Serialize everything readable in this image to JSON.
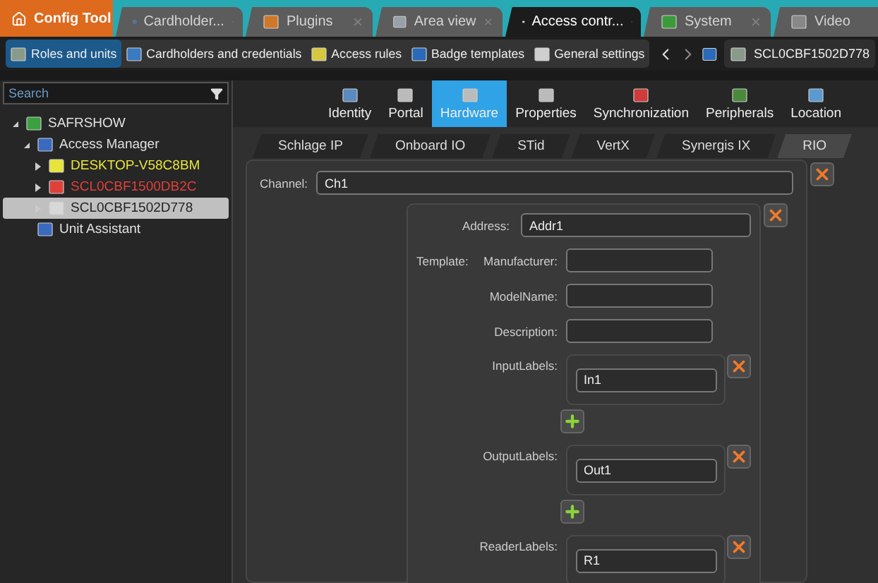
{
  "app_button": {
    "label": "Config Tool"
  },
  "tabs": [
    {
      "label": "Cardholder...",
      "selected": false
    },
    {
      "label": "Plugins",
      "selected": false
    },
    {
      "label": "Area view",
      "selected": false
    },
    {
      "label": "Access contr...",
      "selected": true
    },
    {
      "label": "System",
      "selected": false
    },
    {
      "label": "Video",
      "selected": false
    }
  ],
  "toolbar": {
    "items": [
      {
        "label": "Roles and units",
        "selected": true
      },
      {
        "label": "Cardholders and credentials",
        "selected": false
      },
      {
        "label": "Access rules",
        "selected": false
      },
      {
        "label": "Badge templates",
        "selected": false
      },
      {
        "label": "General settings",
        "selected": false
      }
    ],
    "entity_field": {
      "value": "SCL0CBF1502D778"
    }
  },
  "sidebar": {
    "search": {
      "placeholder": "Search"
    },
    "tree": [
      {
        "label": "SAFRSHOW",
        "selected": false,
        "expanded": true,
        "children": [
          {
            "label": "Access Manager",
            "selected": false,
            "expanded": true,
            "children": [
              {
                "label": "DESKTOP-V58C8BM",
                "selected": false,
                "expanded": false,
                "color": "#e8e43a"
              },
              {
                "label": "SCL0CBF1500DB2C",
                "selected": false,
                "expanded": false,
                "color": "#e0403a"
              },
              {
                "label": "SCL0CBF1502D778",
                "selected": true,
                "expanded": false,
                "color": "#d8d8d8"
              }
            ]
          },
          {
            "label": "Unit Assistant",
            "selected": false
          }
        ]
      }
    ]
  },
  "nav_tabs": [
    {
      "label": "Identity",
      "selected": false
    },
    {
      "label": "Portal",
      "selected": false
    },
    {
      "label": "Hardware",
      "selected": true
    },
    {
      "label": "Properties",
      "selected": false
    },
    {
      "label": "Synchronization",
      "selected": false
    },
    {
      "label": "Peripherals",
      "selected": false
    },
    {
      "label": "Location",
      "selected": false
    }
  ],
  "sub_tabs": [
    {
      "label": "Schlage IP",
      "selected": false
    },
    {
      "label": "Onboard IO",
      "selected": false
    },
    {
      "label": "STid",
      "selected": false
    },
    {
      "label": "VertX",
      "selected": false
    },
    {
      "label": "Synergis IX",
      "selected": false
    },
    {
      "label": "RIO",
      "selected": true
    }
  ],
  "form": {
    "channel": {
      "label": "Channel:",
      "value": "Ch1"
    },
    "address": {
      "label": "Address:",
      "value": "Addr1"
    },
    "template_label": "Template:",
    "template_fields": [
      {
        "label": "Manufacturer:"
      },
      {
        "label": "ModelName:"
      },
      {
        "label": "Description:"
      }
    ],
    "label_lists": [
      {
        "label": "InputLabels:",
        "value": "In1"
      },
      {
        "label": "OutputLabels:",
        "value": "Out1"
      },
      {
        "label": "ReaderLabels:",
        "value": "R1"
      }
    ]
  }
}
